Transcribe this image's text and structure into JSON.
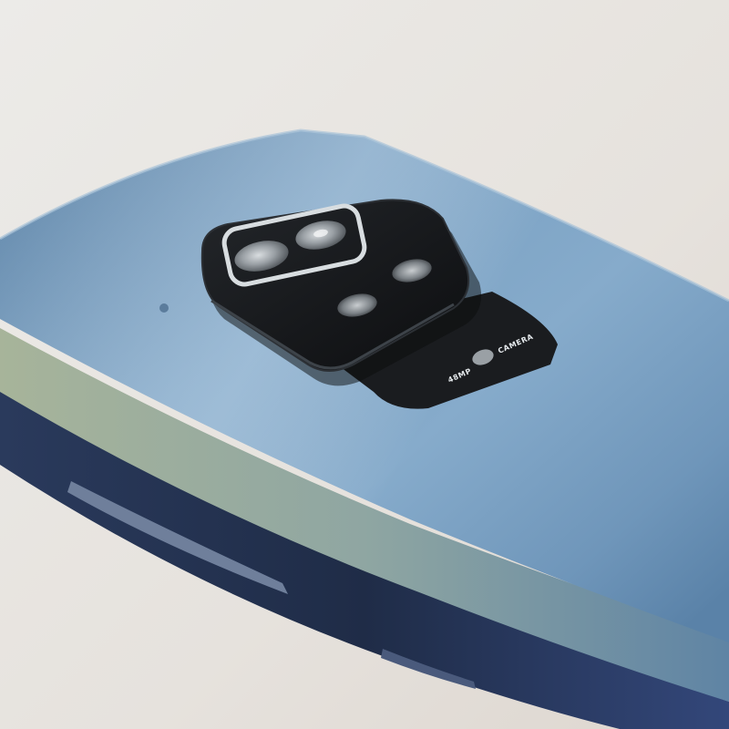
{
  "photo": {
    "subject": "smartphone-back-camera",
    "colors": {
      "background": "#e9e6e2",
      "back_panel": "#7ea3c4",
      "frame_edge": "#25324d",
      "camera_module": "#111315",
      "ring": "#d8dde0"
    }
  },
  "camera_module": {
    "megapixel_label": "48MP",
    "camera_label": "CAMERA"
  }
}
